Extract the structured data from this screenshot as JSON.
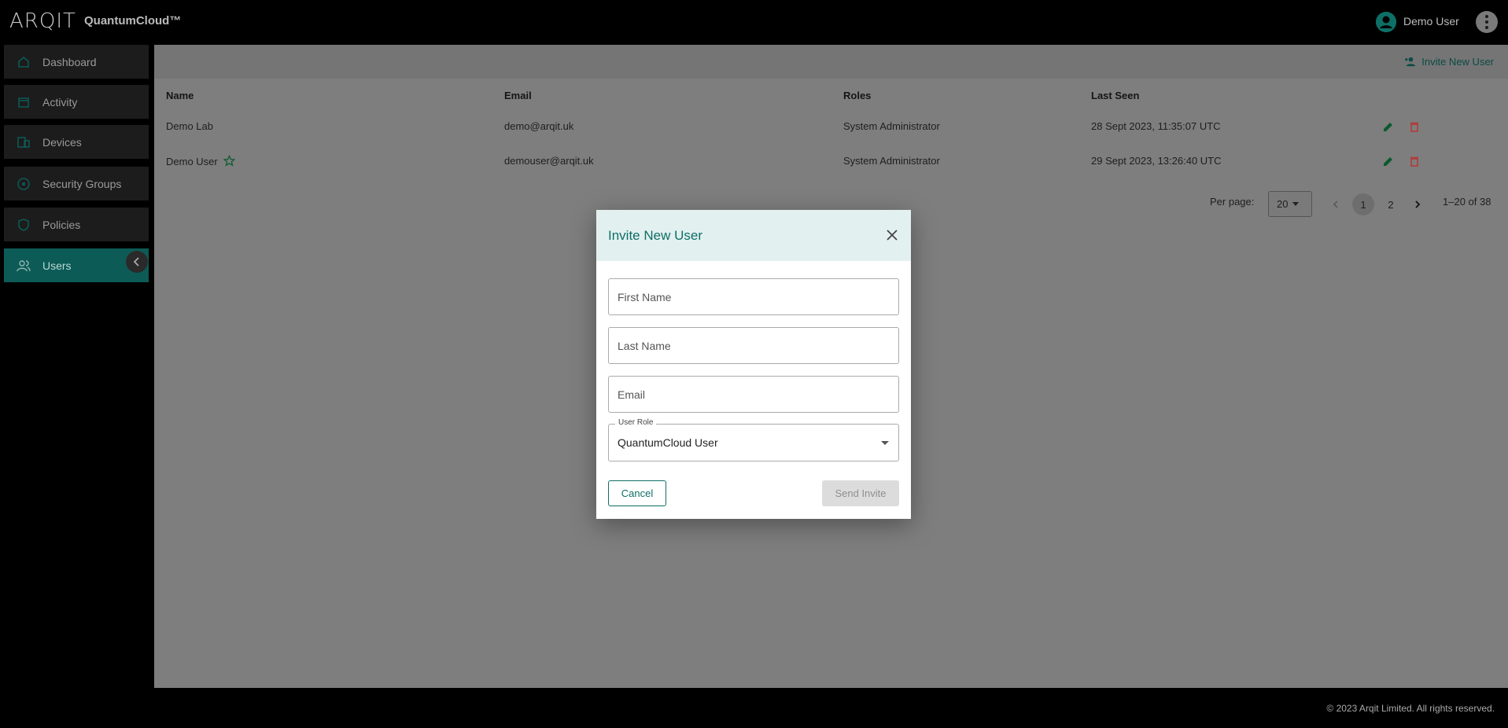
{
  "header": {
    "logo_text": "ARQIT",
    "product_name": "QuantumCloud™",
    "user_name": "Demo User",
    "avatar_icon": "account-circle-icon",
    "menu_icon": "more-vert-icon"
  },
  "sidebar": {
    "items": [
      {
        "label": "Dashboard",
        "icon": "home-icon",
        "active": false
      },
      {
        "label": "Activity",
        "icon": "calendar-icon",
        "active": false
      },
      {
        "label": "Devices",
        "icon": "devices-icon",
        "active": false
      },
      {
        "label": "Security Groups",
        "icon": "hub-icon",
        "active": false
      },
      {
        "label": "Policies",
        "icon": "shield-icon",
        "active": false
      },
      {
        "label": "Users",
        "icon": "people-icon",
        "active": true
      }
    ],
    "collapse_icon": "chevron-left-icon"
  },
  "toolbar": {
    "invite_label": "Invite New User"
  },
  "table": {
    "columns": [
      "Name",
      "Email",
      "Roles",
      "Last Seen"
    ],
    "rows": [
      {
        "name": "Demo Lab",
        "email": "demo@arqit.uk",
        "role": "System Administrator",
        "last_seen": "28 Sept 2023, 11:35:07 UTC",
        "starred": false
      },
      {
        "name": "Demo User",
        "email": "demouser@arqit.uk",
        "role": "System Administrator",
        "last_seen": "29 Sept 2023, 13:26:40 UTC",
        "starred": true
      }
    ]
  },
  "pagination": {
    "per_page_label": "Per page:",
    "per_page_value": "20",
    "pages": [
      "1",
      "2"
    ],
    "current_page": "1",
    "range_text": "1–20 of 38"
  },
  "footer": {
    "copyright": "© 2023 Arqit Limited. All rights reserved."
  },
  "modal": {
    "title": "Invite New User",
    "first_name_placeholder": "First Name",
    "last_name_placeholder": "Last Name",
    "email_placeholder": "Email",
    "role_label": "User Role",
    "role_value": "QuantumCloud User",
    "cancel_label": "Cancel",
    "send_label": "Send Invite"
  },
  "colors": {
    "accent": "#0f6e66",
    "active_nav": "#0d5b56",
    "delete": "#c0392b"
  }
}
